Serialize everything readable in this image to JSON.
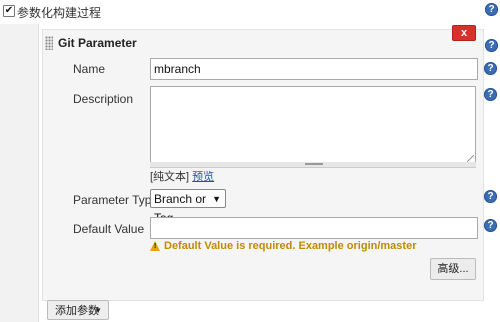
{
  "top": {
    "checkbox_checked": true,
    "check_mark": "✔",
    "label": "参数化构建过程"
  },
  "panel": {
    "title": "Git Parameter",
    "delete_label": "x",
    "name_label": "Name",
    "name_value": "mbranch",
    "description_label": "Description",
    "description_value": "",
    "plain_text_open": "[纯文本] ",
    "preview_link": "预览",
    "param_type_label": "Parameter Type",
    "param_type_value": "Branch or Tag",
    "select_arrow": "▼",
    "default_value_label": "Default Value",
    "default_value_value": "",
    "warning": "Default Value is required. Example origin/master",
    "advanced_button": "高级..."
  },
  "footer": {
    "add_param_button": "添加参数",
    "dropdown_arrow": "▼"
  },
  "help_glyph": "?",
  "colors": {
    "help_blue": "#3b6db5",
    "delete_red": "#d9302c",
    "warning_gold": "#c18a00",
    "link_blue": "#2154a8"
  },
  "icons": {
    "help": "help-icon",
    "warning": "warning-icon",
    "drag": "drag-handle-icon",
    "checkbox": "checkbox"
  }
}
